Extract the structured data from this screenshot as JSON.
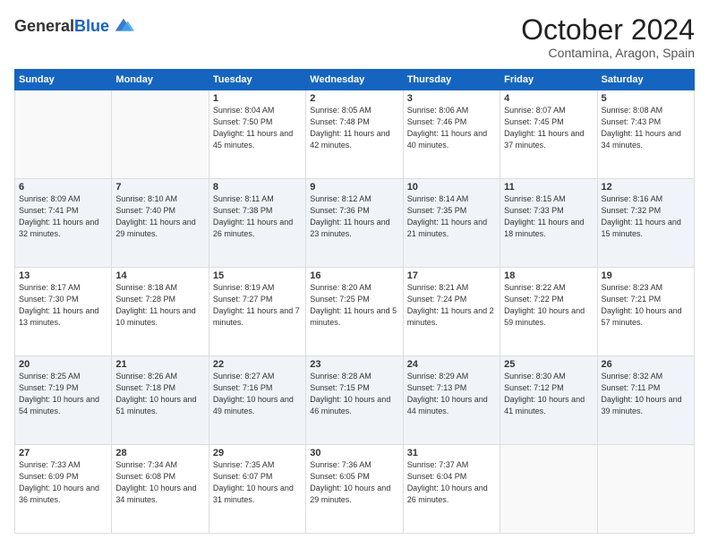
{
  "logo": {
    "general": "General",
    "blue": "Blue"
  },
  "title": "October 2024",
  "location": "Contamina, Aragon, Spain",
  "days_of_week": [
    "Sunday",
    "Monday",
    "Tuesday",
    "Wednesday",
    "Thursday",
    "Friday",
    "Saturday"
  ],
  "weeks": [
    [
      {
        "day": "",
        "info": ""
      },
      {
        "day": "",
        "info": ""
      },
      {
        "day": "1",
        "info": "Sunrise: 8:04 AM\nSunset: 7:50 PM\nDaylight: 11 hours and 45 minutes."
      },
      {
        "day": "2",
        "info": "Sunrise: 8:05 AM\nSunset: 7:48 PM\nDaylight: 11 hours and 42 minutes."
      },
      {
        "day": "3",
        "info": "Sunrise: 8:06 AM\nSunset: 7:46 PM\nDaylight: 11 hours and 40 minutes."
      },
      {
        "day": "4",
        "info": "Sunrise: 8:07 AM\nSunset: 7:45 PM\nDaylight: 11 hours and 37 minutes."
      },
      {
        "day": "5",
        "info": "Sunrise: 8:08 AM\nSunset: 7:43 PM\nDaylight: 11 hours and 34 minutes."
      }
    ],
    [
      {
        "day": "6",
        "info": "Sunrise: 8:09 AM\nSunset: 7:41 PM\nDaylight: 11 hours and 32 minutes."
      },
      {
        "day": "7",
        "info": "Sunrise: 8:10 AM\nSunset: 7:40 PM\nDaylight: 11 hours and 29 minutes."
      },
      {
        "day": "8",
        "info": "Sunrise: 8:11 AM\nSunset: 7:38 PM\nDaylight: 11 hours and 26 minutes."
      },
      {
        "day": "9",
        "info": "Sunrise: 8:12 AM\nSunset: 7:36 PM\nDaylight: 11 hours and 23 minutes."
      },
      {
        "day": "10",
        "info": "Sunrise: 8:14 AM\nSunset: 7:35 PM\nDaylight: 11 hours and 21 minutes."
      },
      {
        "day": "11",
        "info": "Sunrise: 8:15 AM\nSunset: 7:33 PM\nDaylight: 11 hours and 18 minutes."
      },
      {
        "day": "12",
        "info": "Sunrise: 8:16 AM\nSunset: 7:32 PM\nDaylight: 11 hours and 15 minutes."
      }
    ],
    [
      {
        "day": "13",
        "info": "Sunrise: 8:17 AM\nSunset: 7:30 PM\nDaylight: 11 hours and 13 minutes."
      },
      {
        "day": "14",
        "info": "Sunrise: 8:18 AM\nSunset: 7:28 PM\nDaylight: 11 hours and 10 minutes."
      },
      {
        "day": "15",
        "info": "Sunrise: 8:19 AM\nSunset: 7:27 PM\nDaylight: 11 hours and 7 minutes."
      },
      {
        "day": "16",
        "info": "Sunrise: 8:20 AM\nSunset: 7:25 PM\nDaylight: 11 hours and 5 minutes."
      },
      {
        "day": "17",
        "info": "Sunrise: 8:21 AM\nSunset: 7:24 PM\nDaylight: 11 hours and 2 minutes."
      },
      {
        "day": "18",
        "info": "Sunrise: 8:22 AM\nSunset: 7:22 PM\nDaylight: 10 hours and 59 minutes."
      },
      {
        "day": "19",
        "info": "Sunrise: 8:23 AM\nSunset: 7:21 PM\nDaylight: 10 hours and 57 minutes."
      }
    ],
    [
      {
        "day": "20",
        "info": "Sunrise: 8:25 AM\nSunset: 7:19 PM\nDaylight: 10 hours and 54 minutes."
      },
      {
        "day": "21",
        "info": "Sunrise: 8:26 AM\nSunset: 7:18 PM\nDaylight: 10 hours and 51 minutes."
      },
      {
        "day": "22",
        "info": "Sunrise: 8:27 AM\nSunset: 7:16 PM\nDaylight: 10 hours and 49 minutes."
      },
      {
        "day": "23",
        "info": "Sunrise: 8:28 AM\nSunset: 7:15 PM\nDaylight: 10 hours and 46 minutes."
      },
      {
        "day": "24",
        "info": "Sunrise: 8:29 AM\nSunset: 7:13 PM\nDaylight: 10 hours and 44 minutes."
      },
      {
        "day": "25",
        "info": "Sunrise: 8:30 AM\nSunset: 7:12 PM\nDaylight: 10 hours and 41 minutes."
      },
      {
        "day": "26",
        "info": "Sunrise: 8:32 AM\nSunset: 7:11 PM\nDaylight: 10 hours and 39 minutes."
      }
    ],
    [
      {
        "day": "27",
        "info": "Sunrise: 7:33 AM\nSunset: 6:09 PM\nDaylight: 10 hours and 36 minutes."
      },
      {
        "day": "28",
        "info": "Sunrise: 7:34 AM\nSunset: 6:08 PM\nDaylight: 10 hours and 34 minutes."
      },
      {
        "day": "29",
        "info": "Sunrise: 7:35 AM\nSunset: 6:07 PM\nDaylight: 10 hours and 31 minutes."
      },
      {
        "day": "30",
        "info": "Sunrise: 7:36 AM\nSunset: 6:05 PM\nDaylight: 10 hours and 29 minutes."
      },
      {
        "day": "31",
        "info": "Sunrise: 7:37 AM\nSunset: 6:04 PM\nDaylight: 10 hours and 26 minutes."
      },
      {
        "day": "",
        "info": ""
      },
      {
        "day": "",
        "info": ""
      }
    ]
  ]
}
